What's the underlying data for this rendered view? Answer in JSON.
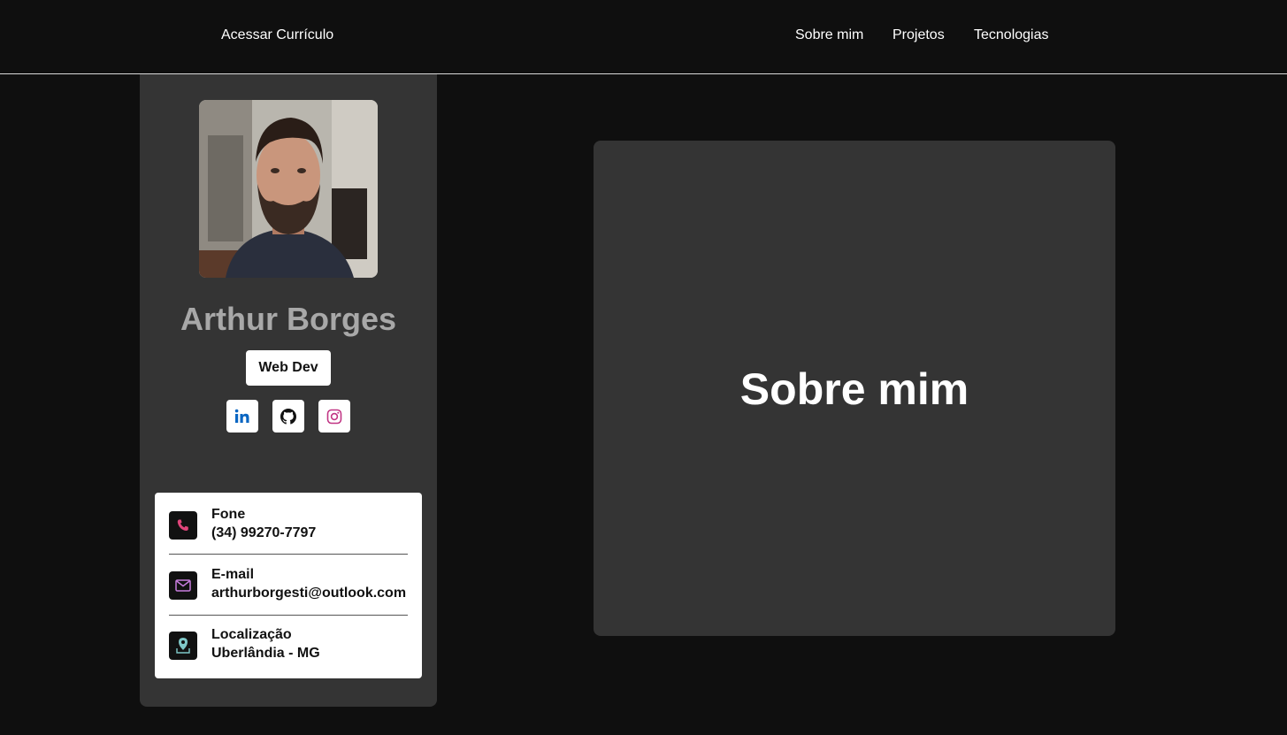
{
  "nav": {
    "cv_link": "Acessar Currículo",
    "links": [
      "Sobre mim",
      "Projetos",
      "Tecnologias"
    ]
  },
  "profile": {
    "name": "Arthur Borges",
    "role": "Web Dev",
    "socials": [
      {
        "icon": "linkedin-icon",
        "color": "#0a66c2"
      },
      {
        "icon": "github-icon",
        "color": "#111111"
      },
      {
        "icon": "instagram-icon",
        "color": "#c13584"
      }
    ],
    "contacts": [
      {
        "label": "Fone",
        "value": "(34) 99270-7797",
        "icon": "phone-icon",
        "color": "#e0457b"
      },
      {
        "label": "E-mail",
        "value": "arthurborgesti@outlook.com",
        "icon": "mail-icon",
        "color": "#c77dde"
      },
      {
        "label": "Localização",
        "value": "Uberlândia - MG",
        "icon": "location-icon",
        "color": "#7fc8c8"
      }
    ]
  },
  "about": {
    "title": "Sobre mim"
  },
  "colors": {
    "background": "#0f0f0f",
    "card": "#343434",
    "name_text": "#a8a8a8"
  }
}
